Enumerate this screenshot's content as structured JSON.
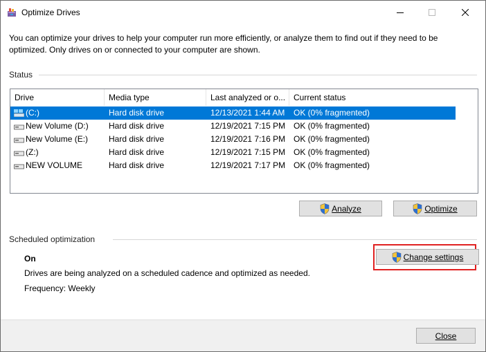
{
  "window": {
    "title": "Optimize Drives",
    "app_icon": "optimize-drives-icon"
  },
  "titlebar": {
    "minimize_icon": "minimize-icon",
    "maximize_icon": "maximize-icon",
    "close_icon": "close-icon"
  },
  "intro": {
    "text": "You can optimize your drives to help your computer run more efficiently, or analyze them to find out if they need to be optimized. Only drives on or connected to your computer are shown."
  },
  "status": {
    "label": "Status",
    "columns": [
      "Drive",
      "Media type",
      "Last analyzed or o...",
      "Current status"
    ],
    "rows": [
      {
        "drive": "(C:)",
        "media": "Hard disk drive",
        "last": "12/13/2021 1:44 AM",
        "status": "OK (0% fragmented)",
        "icon": "windows-drive-icon",
        "selected": true
      },
      {
        "drive": "New Volume (D:)",
        "media": "Hard disk drive",
        "last": "12/19/2021 7:15 PM",
        "status": "OK (0% fragmented)",
        "icon": "drive-icon",
        "selected": false
      },
      {
        "drive": "New Volume (E:)",
        "media": "Hard disk drive",
        "last": "12/19/2021 7:16 PM",
        "status": "OK (0% fragmented)",
        "icon": "drive-icon",
        "selected": false
      },
      {
        "drive": "(Z:)",
        "media": "Hard disk drive",
        "last": "12/19/2021 7:15 PM",
        "status": "OK (0% fragmented)",
        "icon": "drive-icon",
        "selected": false
      },
      {
        "drive": "NEW VOLUME",
        "media": "Hard disk drive",
        "last": "12/19/2021 7:17 PM",
        "status": "OK (0% fragmented)",
        "icon": "drive-icon",
        "selected": false
      }
    ],
    "analyze_label": "Analyze",
    "optimize_label": "Optimize"
  },
  "scheduled": {
    "label": "Scheduled optimization",
    "state": "On",
    "description": "Drives are being analyzed on a scheduled cadence and optimized as needed.",
    "frequency": "Frequency: Weekly",
    "change_settings_label": "Change settings"
  },
  "footer": {
    "close_label": "Close"
  },
  "colors": {
    "selection": "#0078d7",
    "highlight_border": "#e02020",
    "button_face": "#e1e1e1"
  }
}
